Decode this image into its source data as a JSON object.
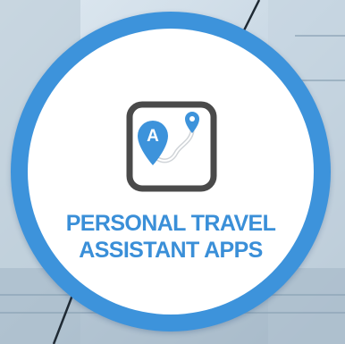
{
  "badge": {
    "title_line1": "PERSONAL TRAVEL",
    "title_line2": "ASSISTANT APPS",
    "icon_letter": "A",
    "accent_color": "#3d93db",
    "title_color": "#3a8fd8",
    "icon_frame_color": "#4a4a4a",
    "pin_color": "#3d93db",
    "icon": "route-map-pin-icon"
  }
}
